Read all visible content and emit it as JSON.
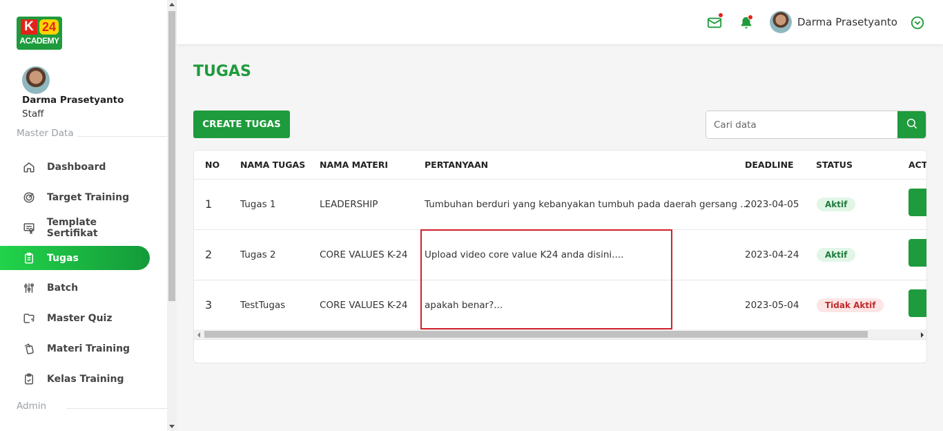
{
  "brand": {
    "logo_k": "K",
    "logo_24": "24",
    "logo_academy": "ACADEMY"
  },
  "sidebar": {
    "user_name": "Darma Prasetyanto",
    "user_role": "Staff",
    "section_master": "Master Data",
    "section_admin": "Admin",
    "items": [
      {
        "label": "Dashboard",
        "icon": "home-icon"
      },
      {
        "label": "Target Training",
        "icon": "target-icon"
      },
      {
        "label": "Template Sertifikat",
        "icon": "certificate-icon"
      },
      {
        "label": "Tugas",
        "icon": "clipboard-icon",
        "active": true
      },
      {
        "label": "Batch",
        "icon": "sliders-icon"
      },
      {
        "label": "Master Quiz",
        "icon": "quiz-icon"
      },
      {
        "label": "Materi Training",
        "icon": "cards-icon"
      },
      {
        "label": "Kelas Training",
        "icon": "clipboard-check-icon"
      }
    ]
  },
  "topbar": {
    "user_name": "Darma Prasetyanto"
  },
  "page": {
    "title": "TUGAS",
    "create_label": "CREATE TUGAS",
    "search_placeholder": "Cari data"
  },
  "table": {
    "headers": [
      "NO",
      "NAMA TUGAS",
      "NAMA MATERI",
      "PERTANYAAN",
      "DEADLINE",
      "STATUS",
      "ACTI"
    ],
    "rows": [
      {
        "no": "1",
        "nama_tugas": "Tugas 1",
        "nama_materi": "LEADERSHIP",
        "pertanyaan": "Tumbuhan berduri yang kebanyakan tumbuh pada daerah gersang ...",
        "deadline": "2023-04-05",
        "status": "Aktif"
      },
      {
        "no": "2",
        "nama_tugas": "Tugas 2",
        "nama_materi": "CORE VALUES K-24",
        "pertanyaan": "Upload video core value K24 anda disini....",
        "deadline": "2023-04-24",
        "status": "Aktif"
      },
      {
        "no": "3",
        "nama_tugas": "TestTugas",
        "nama_materi": "CORE VALUES K-24",
        "pertanyaan": "apakah benar?...",
        "deadline": "2023-05-04",
        "status": "Tidak Aktif"
      }
    ]
  },
  "colors": {
    "brand_green": "#1e9b3c",
    "highlight_red": "#d0202a"
  }
}
